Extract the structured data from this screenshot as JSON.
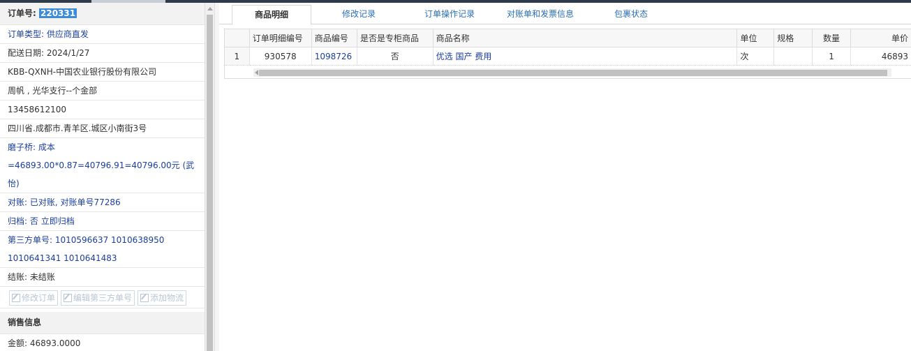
{
  "order": {
    "id_label": "订单号:",
    "id_value": "220331",
    "type_label": "订单类型:",
    "type_value": "供应商直发",
    "delivery_date": "配送日期:  2024/1/27",
    "customer": "KBB-QXNH-中国农业银行股份有限公司",
    "contact": "周帆 , 光华支行--个金部",
    "phone": "13458612100",
    "address": "四川省.成都市.青羊区.城区小南街3号",
    "note_label": "磨子桥:",
    "note_value": "成本=46893.00*0.87=40796.91=40796.00元 (武怡)",
    "reconcile_label": "对账:",
    "reconcile_value": "已对账, 对账单号77286",
    "archive_label": "归档:",
    "archive_value": " 否 立即归档",
    "third_party_label": "第三方单号:",
    "third_party_value": "1010596637 1010638950 1010641341 1010641483",
    "settle_label": "结账:",
    "settle_value": "未结账"
  },
  "actions": {
    "edit_order": "修改订单",
    "edit_third_party": "编辑第三方单号",
    "add_logistics": "添加物流"
  },
  "sales": {
    "section_title": "销售信息",
    "amount_label": "金额:",
    "amount_value": "46893.0000"
  },
  "tabs": [
    "商品明细",
    "修改记录",
    "订单操作记录",
    "对账单和发票信息",
    "包裹状态"
  ],
  "table": {
    "headers": [
      "",
      "订单明细编号",
      "商品编号",
      "是否是专柜商品",
      "商品名称",
      "单位",
      "规格",
      "数量",
      "单价"
    ],
    "rows": [
      [
        "1",
        "930578",
        "1098726",
        "否",
        "优选 国产 费用",
        "次",
        "",
        "1",
        "46893"
      ]
    ]
  },
  "colors": {
    "link": "#1a3fa0",
    "highlight": "#3b8bd6",
    "tab_link": "#2a6fb6"
  }
}
